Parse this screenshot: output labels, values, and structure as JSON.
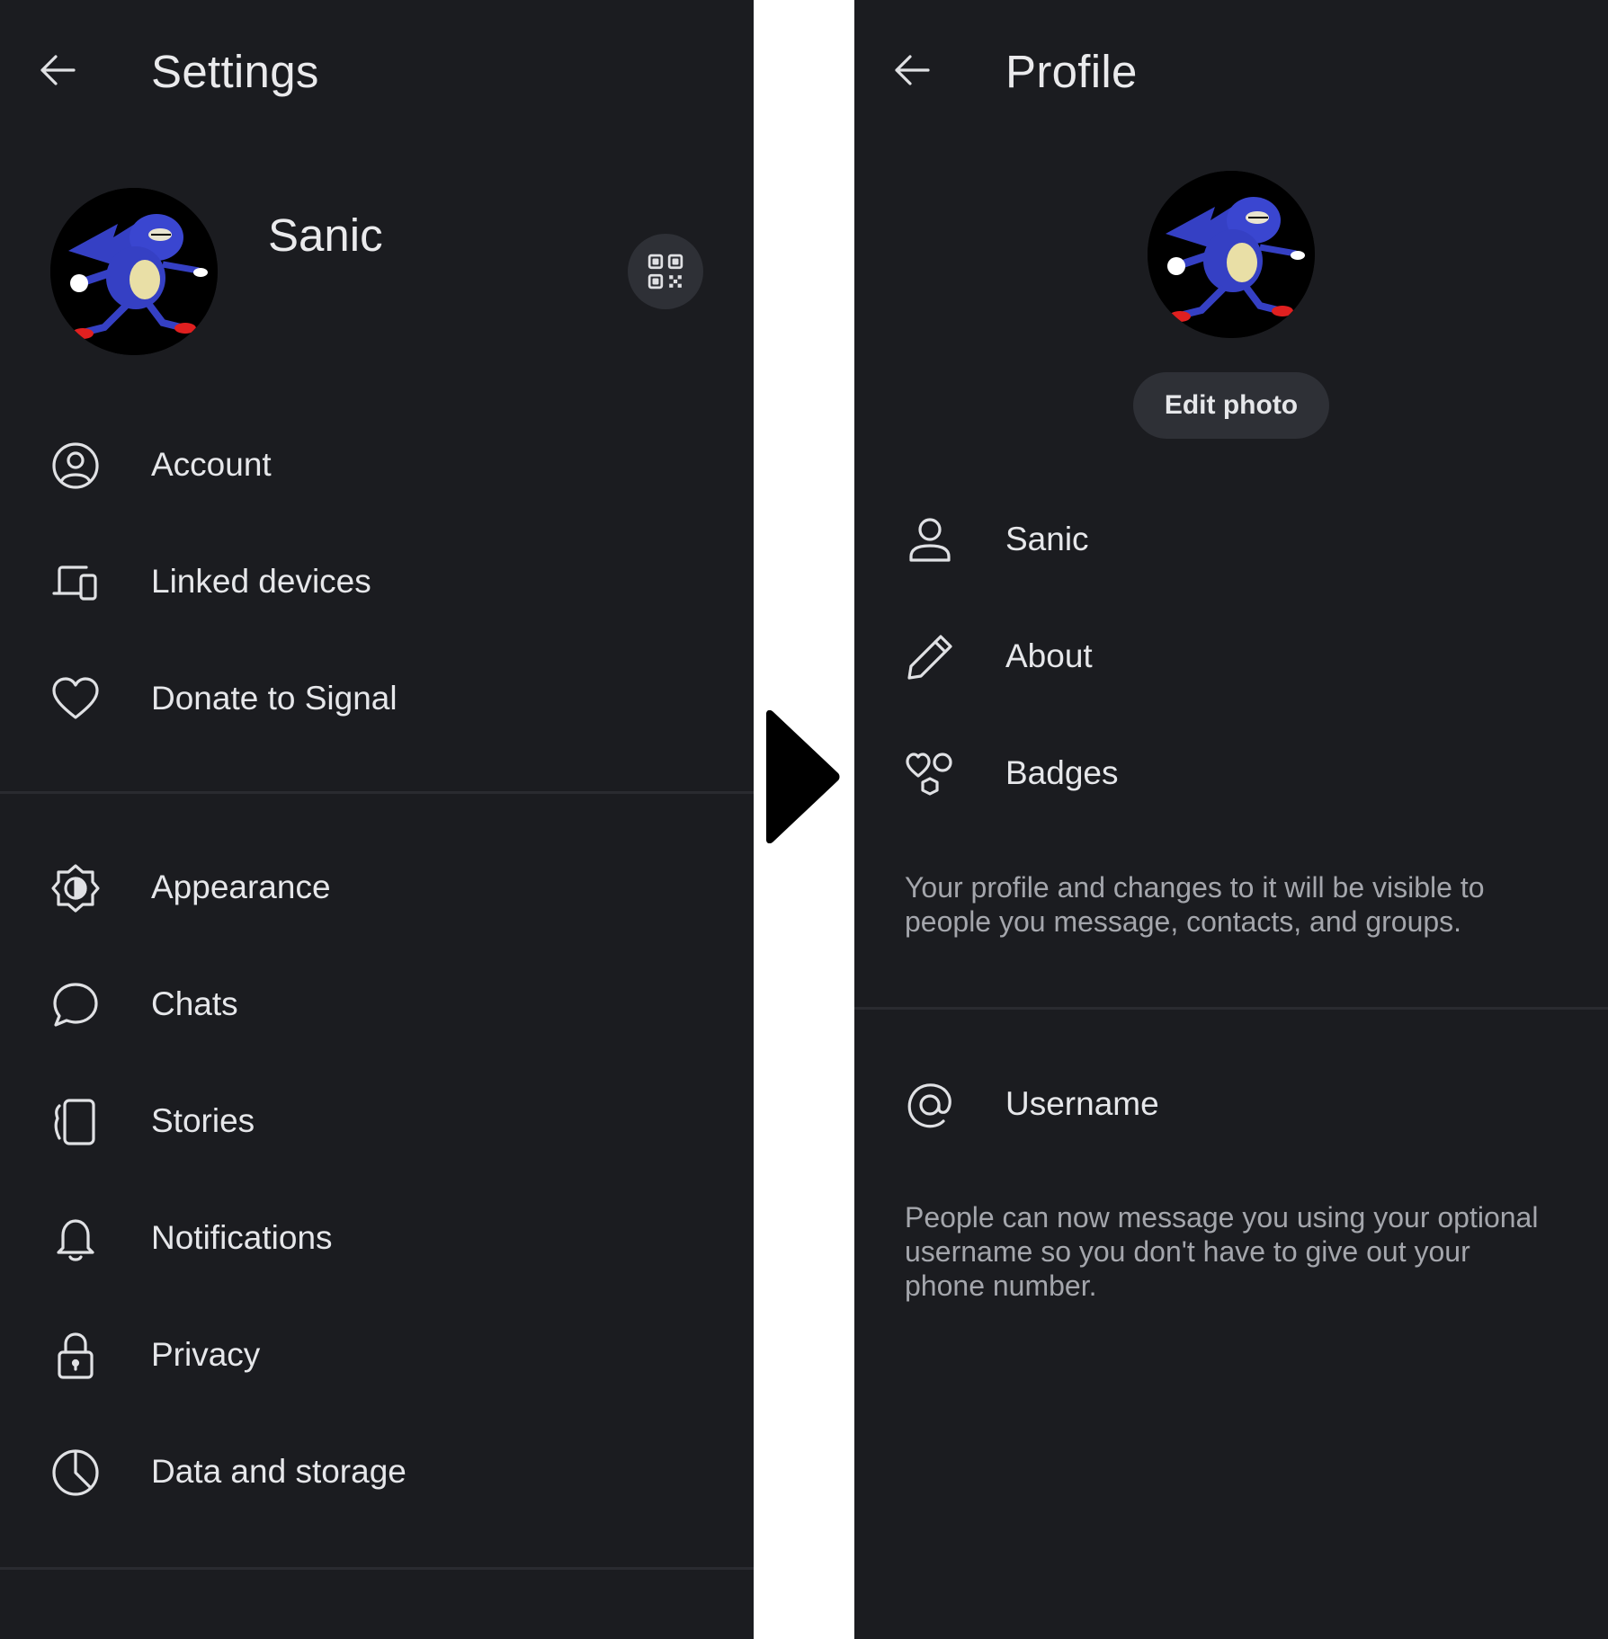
{
  "settings": {
    "title": "Settings",
    "profile_name": "Sanic",
    "menu_group1": [
      {
        "label": "Account",
        "icon": "account-icon"
      },
      {
        "label": "Linked devices",
        "icon": "linked-devices-icon"
      },
      {
        "label": "Donate to Signal",
        "icon": "heart-icon"
      }
    ],
    "menu_group2": [
      {
        "label": "Appearance",
        "icon": "appearance-icon"
      },
      {
        "label": "Chats",
        "icon": "chat-bubble-icon"
      },
      {
        "label": "Stories",
        "icon": "stories-icon"
      },
      {
        "label": "Notifications",
        "icon": "bell-icon"
      },
      {
        "label": "Privacy",
        "icon": "lock-icon"
      },
      {
        "label": "Data and storage",
        "icon": "pie-chart-icon"
      }
    ]
  },
  "profile": {
    "title": "Profile",
    "edit_photo_label": "Edit photo",
    "items": [
      {
        "label": "Sanic",
        "icon": "person-icon"
      },
      {
        "label": "About",
        "icon": "pencil-icon"
      },
      {
        "label": "Badges",
        "icon": "badges-icon"
      }
    ],
    "visibility_note": "Your profile and changes to it will be visible to people you message, contacts, and groups.",
    "username_label": "Username",
    "username_note": "People can now message you using your optional username so you don't have to give out your phone number."
  },
  "colors": {
    "background": "#1b1c20",
    "text": "#e6e7ea",
    "secondary_text": "#a4a6ac",
    "button_bg": "#2e3036",
    "separator": "#ffffff"
  }
}
